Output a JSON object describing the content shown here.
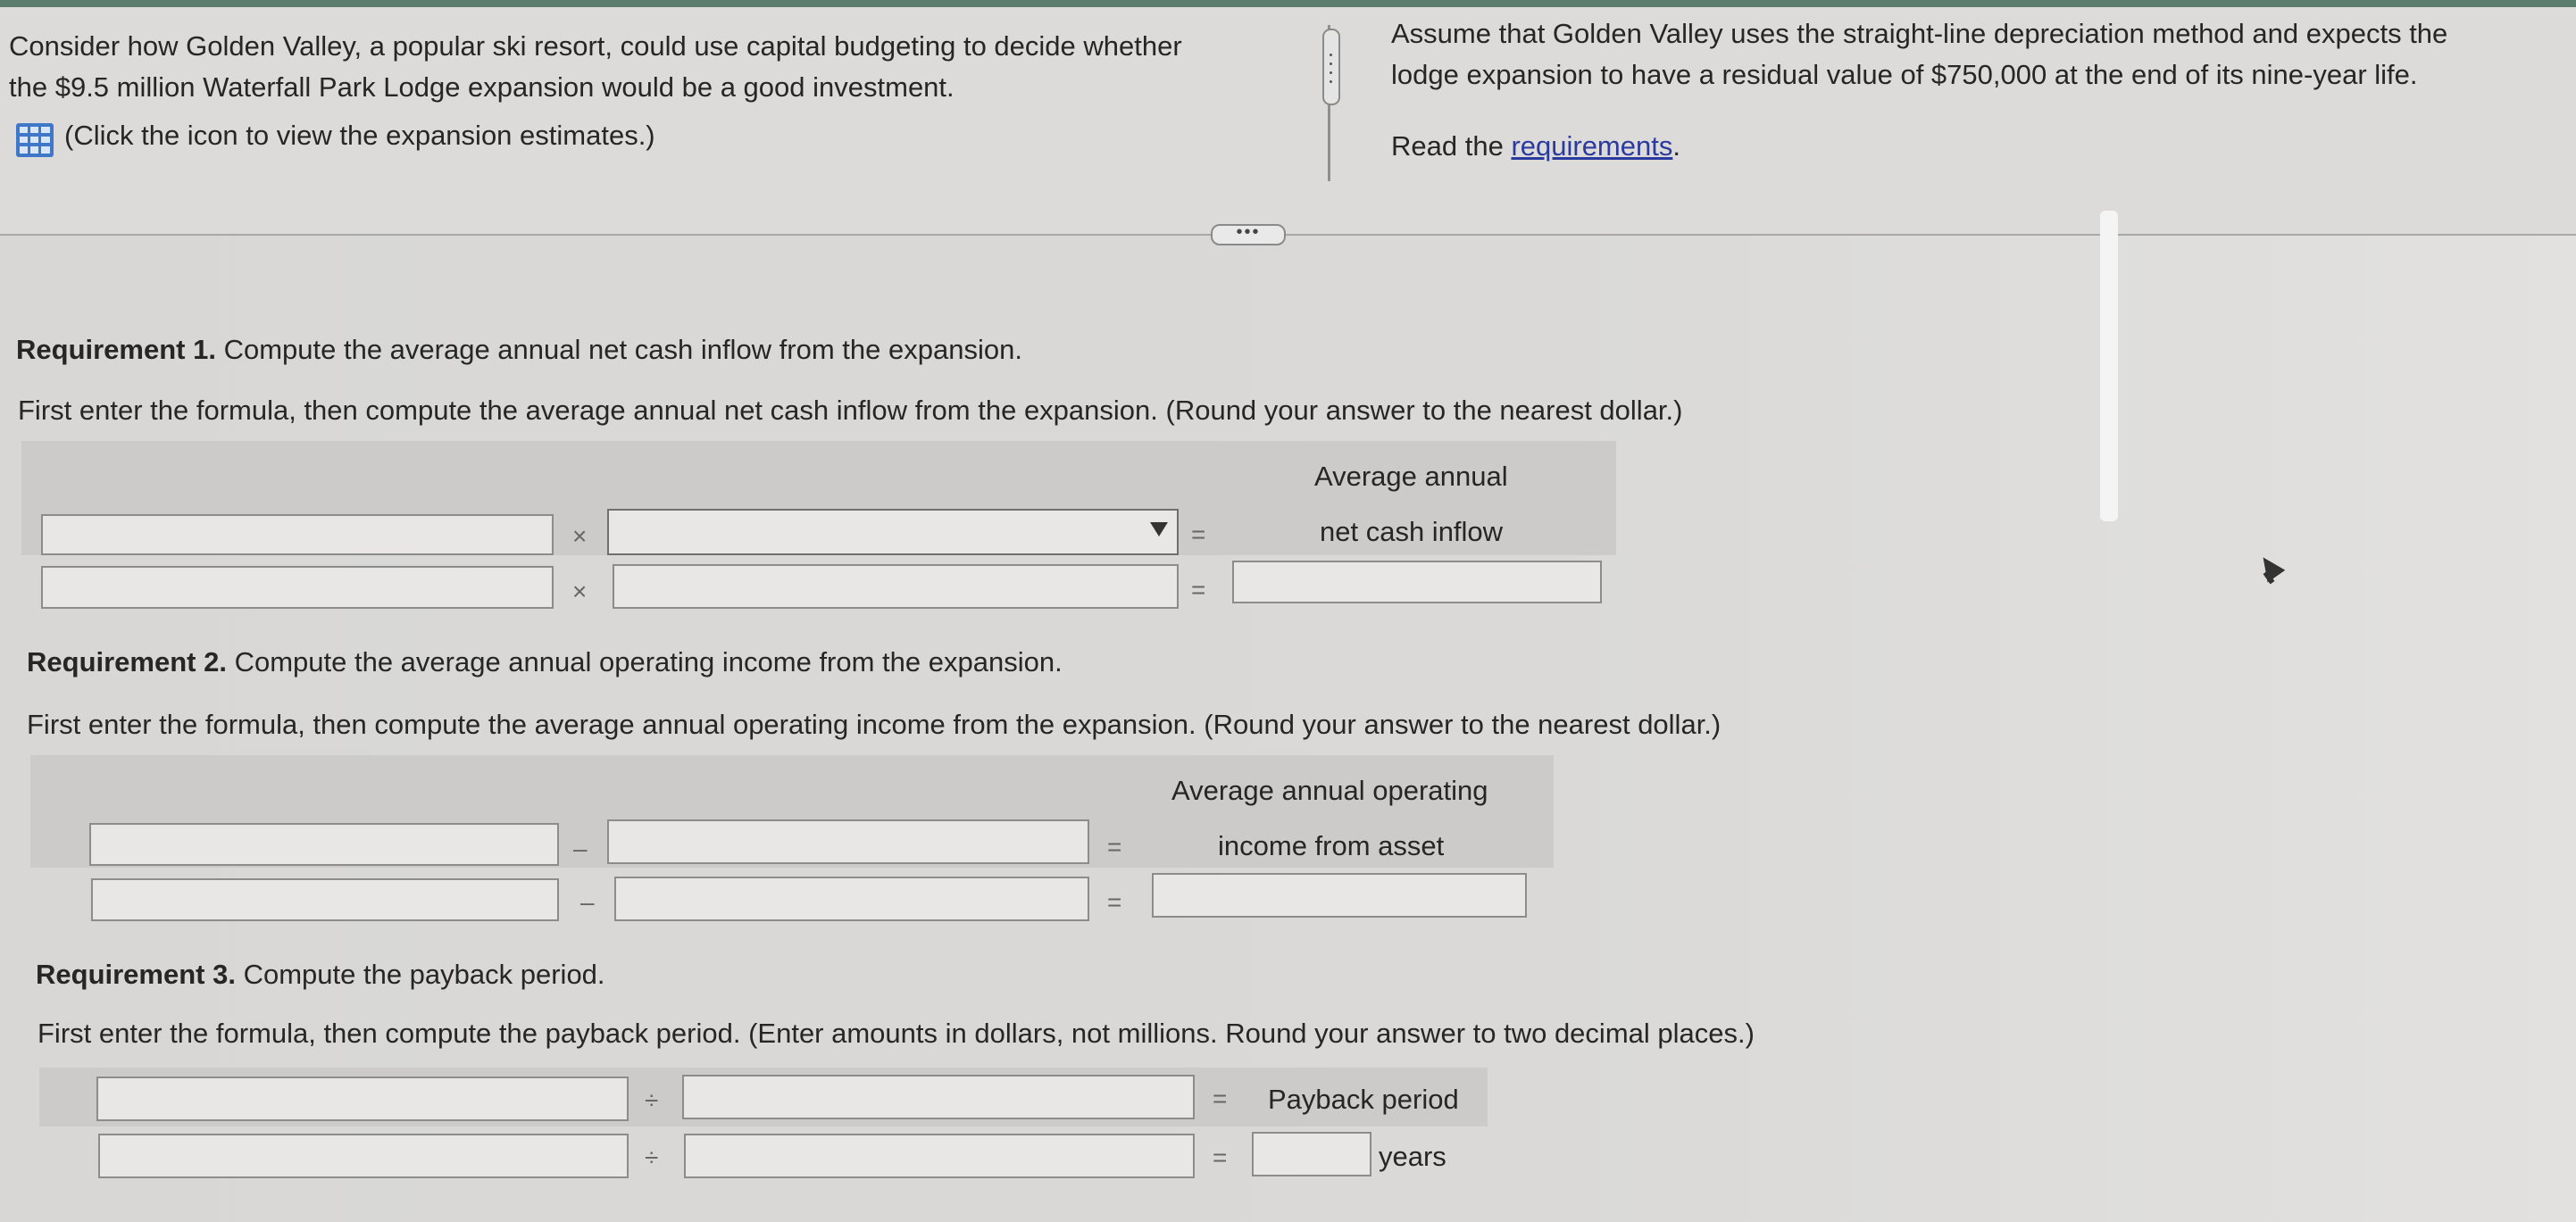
{
  "problem": {
    "line1": "Consider how Golden Valley, a popular ski resort, could use capital budgeting to decide whether",
    "line2": "the $9.5 million Waterfall Park Lodge expansion would be a good investment.",
    "estimates_link": "(Click the icon to view the expansion estimates.)",
    "assume_line1": "Assume that Golden Valley uses the straight-line depreciation method and expects the",
    "assume_line2": "lodge expansion to have a residual value of $750,000 at the end of its nine-year life.",
    "read_prefix": "Read the ",
    "requirements_link": "requirements",
    "read_suffix": "."
  },
  "collapse_handle": "•••",
  "req1": {
    "title_bold": "Requirement 1.",
    "title_rest": " Compute the average annual net cash inflow from the expansion.",
    "instruction": "First enter the formula, then compute the average annual net cash inflow from the expansion. (Round your answer to the nearest dollar.)",
    "header_line1": "Average annual",
    "header_line2": "net cash inflow",
    "operator": "×",
    "equals": "="
  },
  "req2": {
    "title_bold": "Requirement 2.",
    "title_rest": " Compute the average annual operating income from the expansion.",
    "instruction": "First enter the formula, then compute the average annual operating income from the expansion. (Round your answer to the nearest dollar.)",
    "header_line1": "Average annual operating",
    "header_line2": "income from asset",
    "operator": "–",
    "equals": "="
  },
  "req3": {
    "title_bold": "Requirement 3.",
    "title_rest": " Compute the payback period.",
    "instruction": "First enter the formula, then compute the payback period. (Enter amounts in dollars, not millions. Round your answer to two decimal places.)",
    "header": "Payback period",
    "operator": "÷",
    "equals": "=",
    "unit": "years"
  },
  "colors": {
    "link": "#2b3a9e",
    "band": "#cccbc9",
    "top_strip": "#5a7d6e"
  }
}
